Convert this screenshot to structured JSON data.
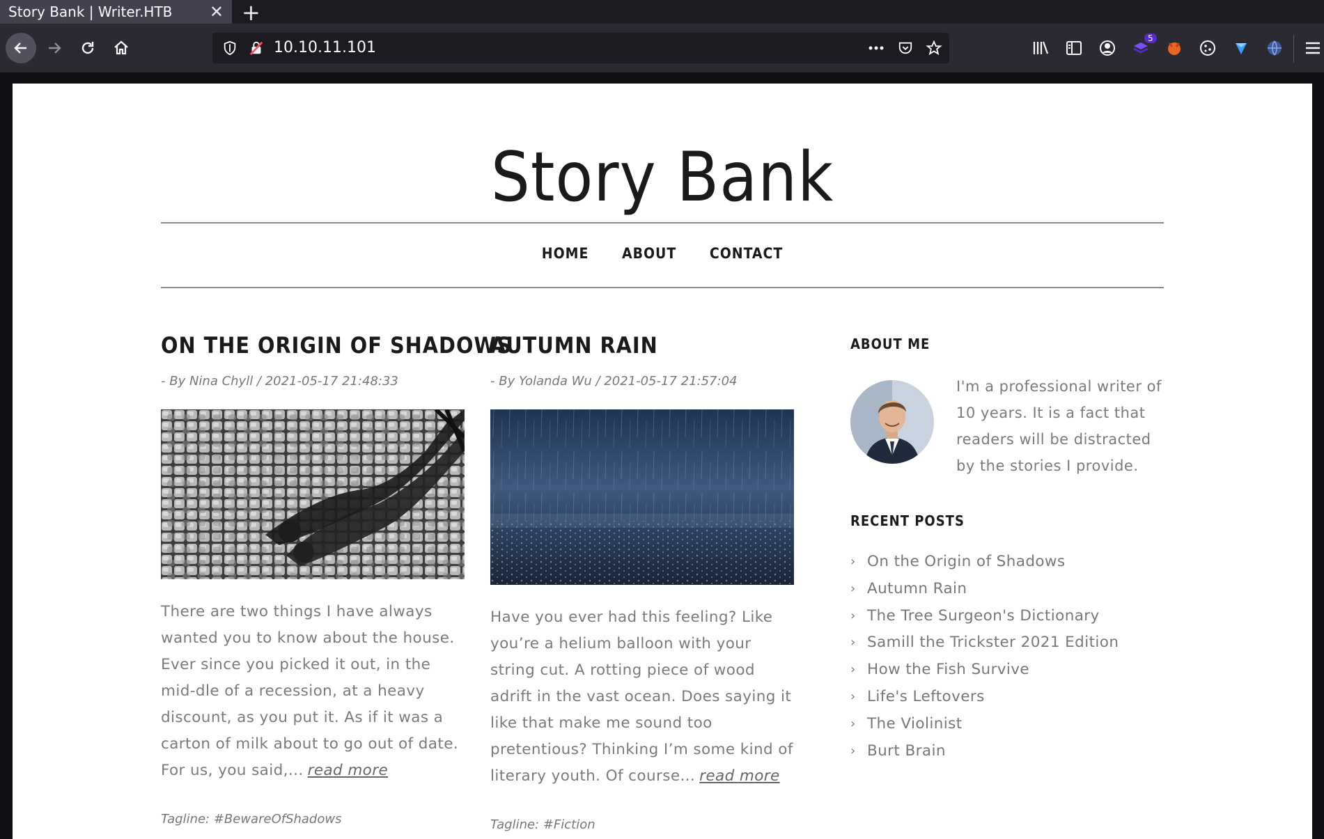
{
  "browser": {
    "tab_title": "Story Bank | Writer.HTB",
    "tab_close": "✕",
    "new_tab": "+",
    "url": "10.10.11.101",
    "extension_badge": "5",
    "icons": [
      "back-icon",
      "forward-icon",
      "reload-icon",
      "home-icon",
      "shield-icon",
      "insecure-lock-icon",
      "more-icon",
      "pocket-icon",
      "star-icon",
      "library-icon",
      "sidebar-icon",
      "account-icon",
      "extension-icons",
      "menu-icon"
    ]
  },
  "site": {
    "title": "Story Bank",
    "menu": [
      "HOME",
      "ABOUT",
      "CONTACT"
    ]
  },
  "posts": [
    {
      "title": "ON THE ORIGIN OF SHADOWS",
      "meta": "- By Nina Chyll / 2021-05-17 21:48:33",
      "image": "shadows-photo",
      "excerpt": "There are two things I have always wanted you to know about the house. Ever since you picked it out, in the mid-dle of a recession, at a heavy discount, as you put it. As if it was a carton of milk about to go out of date. For us, you said,...",
      "read_more": "read more",
      "tagline": "Tagline: #BewareOfShadows"
    },
    {
      "title": "AUTUMN RAIN",
      "meta": "- By Yolanda Wu / 2021-05-17 21:57:04",
      "image": "rain-photo",
      "excerpt": "Have you ever had this feeling? Like you’re a helium balloon with your string cut. A rotting piece of wood adrift in the vast ocean. Does saying it like that make me sound too pretentious? Thinking I’m some kind of literary youth. Of course...",
      "read_more": "read more",
      "tagline": "Tagline: #Fiction"
    }
  ],
  "sidebar": {
    "about_heading": "ABOUT ME",
    "about_text": "I'm a professional writer of 10 years. It is a fact that readers will be distracted by the stories I provide.",
    "recent_heading": "RECENT POSTS",
    "recent_posts": [
      "On the Origin of Shadows",
      "Autumn Rain",
      "The Tree Surgeon's Dictionary",
      "Samill the Trickster 2021 Edition",
      "How the Fish Survive",
      "Life's Leftovers",
      "The Violinist",
      "Burt Brain"
    ]
  }
}
